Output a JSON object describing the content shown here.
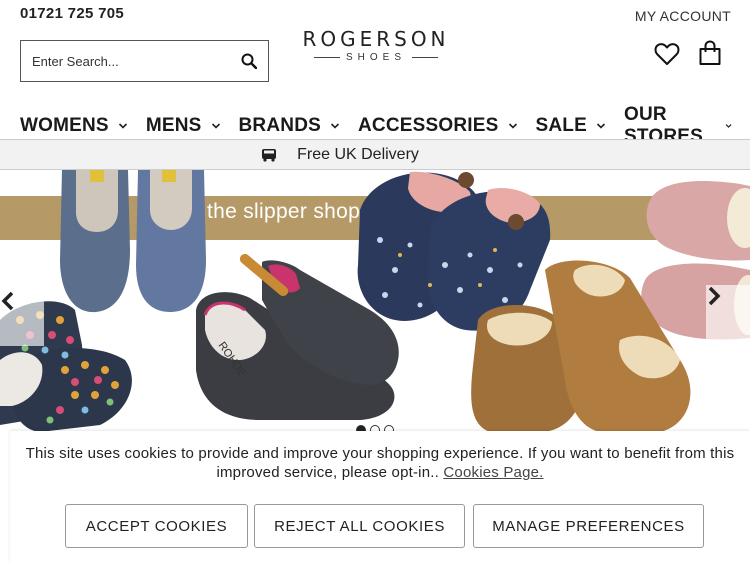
{
  "header": {
    "phone": "01721 725 705",
    "account_label": "MY ACCOUNT",
    "search_placeholder": "Enter Search...",
    "logo_line1": "ROGERSON",
    "logo_line2": "SHOES",
    "icons": [
      "search-icon",
      "heart-icon",
      "shopping-bag-icon"
    ]
  },
  "nav": {
    "items": [
      {
        "label": "WOMENS"
      },
      {
        "label": "MENS"
      },
      {
        "label": "BRANDS"
      },
      {
        "label": "ACCESSORIES"
      },
      {
        "label": "SALE"
      },
      {
        "label": "OUR STORES"
      }
    ]
  },
  "delivery": {
    "text": "Free UK Delivery",
    "icon": "truck-icon"
  },
  "hero": {
    "banner_text": "the slipper shop",
    "slide_count": 3,
    "active_slide": 1,
    "slipper_brand_text": "ROHDE",
    "banner_color": "#b59a67"
  },
  "cookie": {
    "message": "This site uses cookies to provide and improve your shopping experience. If you want to benefit from this improved service, please opt-in..",
    "link_label": "Cookies Page.",
    "accept_label": "ACCEPT COOKIES",
    "reject_label": "REJECT ALL COOKIES",
    "manage_label": "MANAGE PREFERENCES"
  }
}
